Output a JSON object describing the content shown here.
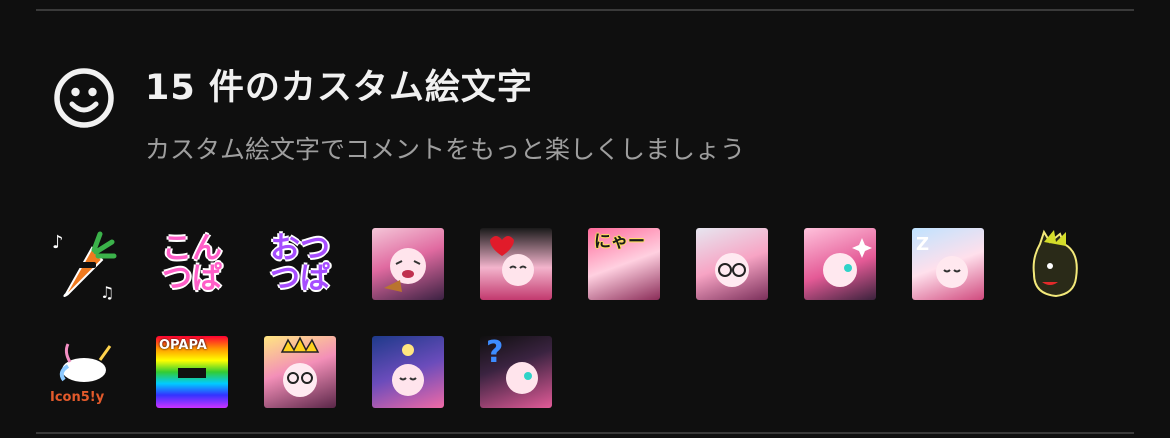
{
  "header": {
    "title": "15 件のカスタム絵文字",
    "subtitle": "カスタム絵文字でコメントをもっと楽しくしましょう",
    "icon": "smiley-icon"
  },
  "emojis": [
    {
      "name": "carrot-sunglasses",
      "text": ""
    },
    {
      "name": "konpa",
      "text": "こん\nつぱ"
    },
    {
      "name": "otsupa",
      "text": "おつ\nつぱ"
    },
    {
      "name": "character-eating",
      "text": ""
    },
    {
      "name": "character-heart",
      "text": ""
    },
    {
      "name": "character-nya",
      "text": "にゃー"
    },
    {
      "name": "character-glasses",
      "text": ""
    },
    {
      "name": "character-sparkle",
      "text": ""
    },
    {
      "name": "character-sleeping",
      "text": ""
    },
    {
      "name": "horse",
      "text": ""
    },
    {
      "name": "unicorn",
      "text": "Icon5!y"
    },
    {
      "name": "rainbow-opapa",
      "text": "OPAPA"
    },
    {
      "name": "character-crown",
      "text": ""
    },
    {
      "name": "character-night",
      "text": ""
    },
    {
      "name": "character-question",
      "text": "?"
    }
  ]
}
